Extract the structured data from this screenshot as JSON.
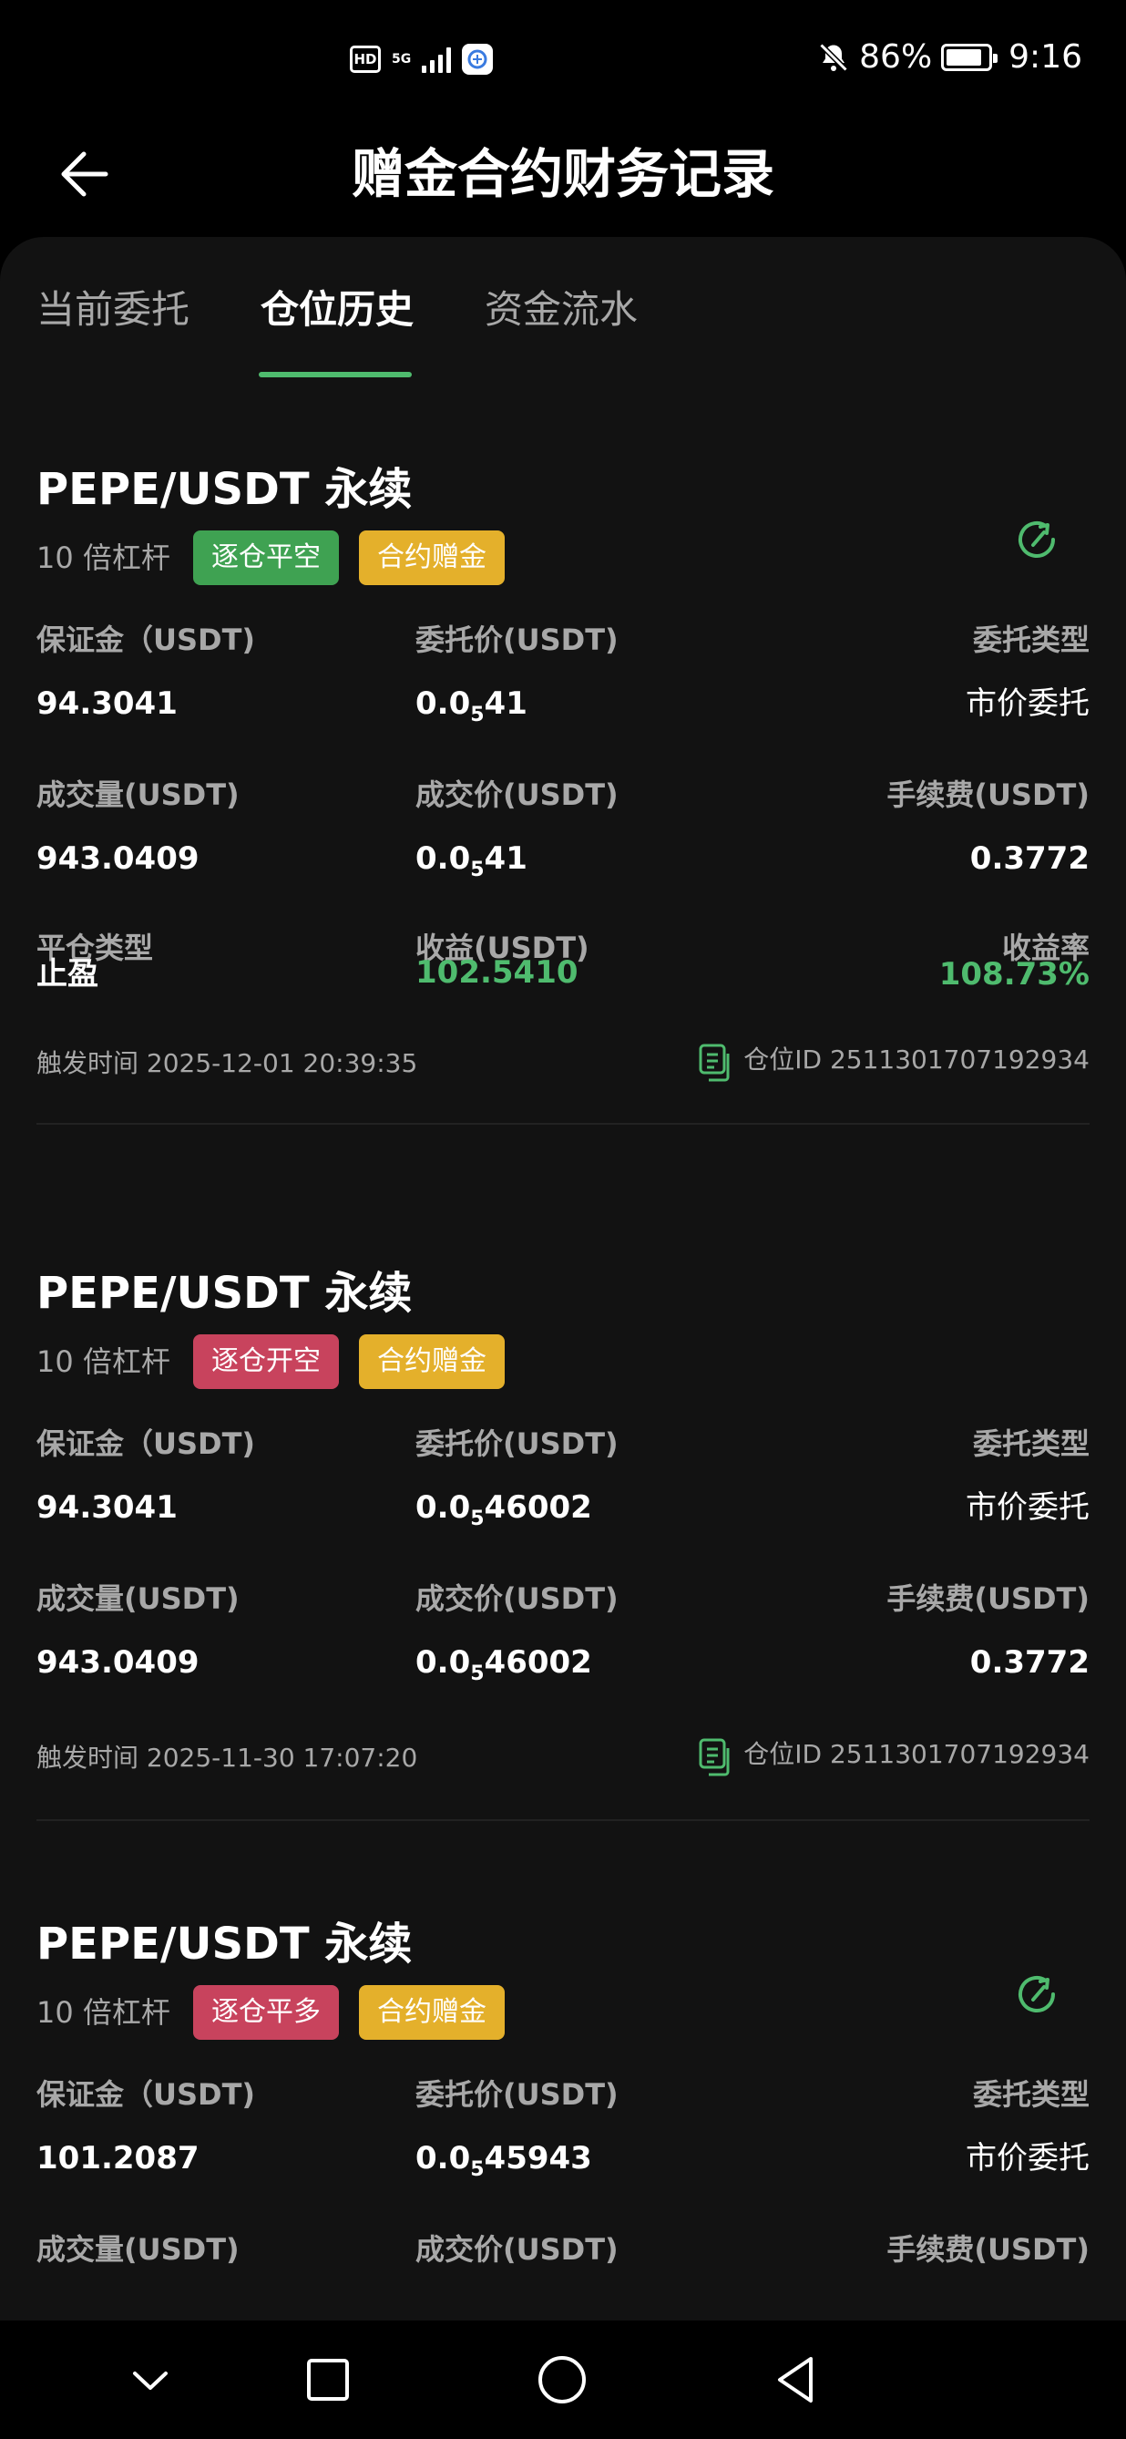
{
  "status_bar": {
    "hd": "HD",
    "network": "5G",
    "battery_percent": "86%",
    "battery_level": 0.86,
    "time": "9:16"
  },
  "header": {
    "title": "赠金合约财务记录"
  },
  "tabs": [
    {
      "label": "当前委托",
      "active": false
    },
    {
      "label": "仓位历史",
      "active": true
    },
    {
      "label": "资金流水",
      "active": false
    }
  ],
  "labels": {
    "margin": "保证金（USDT)",
    "order_price": "委托价(USDT)",
    "order_type": "委托类型",
    "volume": "成交量(USDT)",
    "fill_price": "成交价(USDT)",
    "fee": "手续费(USDT)",
    "close_type": "平仓类型",
    "profit": "收益(USDT)",
    "profit_rate": "收益率",
    "trigger_time": "触发时间",
    "position_id": "仓位ID"
  },
  "records": [
    {
      "pair": "PEPE/USDT 永续",
      "leverage": "10 倍杠杆",
      "side_tag": "逐仓平空",
      "side_color": "#3fa252",
      "bonus_tag": "合约赠金",
      "margin": "94.3041",
      "order_price": {
        "prefix": "0.0",
        "sub": "5",
        "rest": "41"
      },
      "order_type": "市价委托",
      "volume": "943.0409",
      "fill_price": {
        "prefix": "0.0",
        "sub": "5",
        "rest": "41"
      },
      "fee": "0.3772",
      "close_type": "止盈",
      "profit": "102.5410",
      "profit_rate": "108.73%",
      "trigger_time": "2025-12-01 20:39:35",
      "position_id": "2511301707192934"
    },
    {
      "pair": "PEPE/USDT 永续",
      "leverage": "10 倍杠杆",
      "side_tag": "逐仓开空",
      "side_color": "#c8435d",
      "bonus_tag": "合约赠金",
      "margin": "94.3041",
      "order_price": {
        "prefix": "0.0",
        "sub": "5",
        "rest": "46002"
      },
      "order_type": "市价委托",
      "volume": "943.0409",
      "fill_price": {
        "prefix": "0.0",
        "sub": "5",
        "rest": "46002"
      },
      "fee": "0.3772",
      "trigger_time": "2025-11-30 17:07:20",
      "position_id": "2511301707192934"
    },
    {
      "pair": "PEPE/USDT 永续",
      "leverage": "10 倍杠杆",
      "side_tag": "逐仓平多",
      "side_color": "#c8435d",
      "bonus_tag": "合约赠金",
      "margin": "101.2087",
      "order_price": {
        "prefix": "0.0",
        "sub": "5",
        "rest": "45943"
      },
      "order_type": "市价委托"
    }
  ],
  "colors": {
    "accent_green": "#4fbb6e",
    "tag_yellow": "#e4b02b",
    "tag_red": "#c8435d",
    "background": "#121212"
  }
}
